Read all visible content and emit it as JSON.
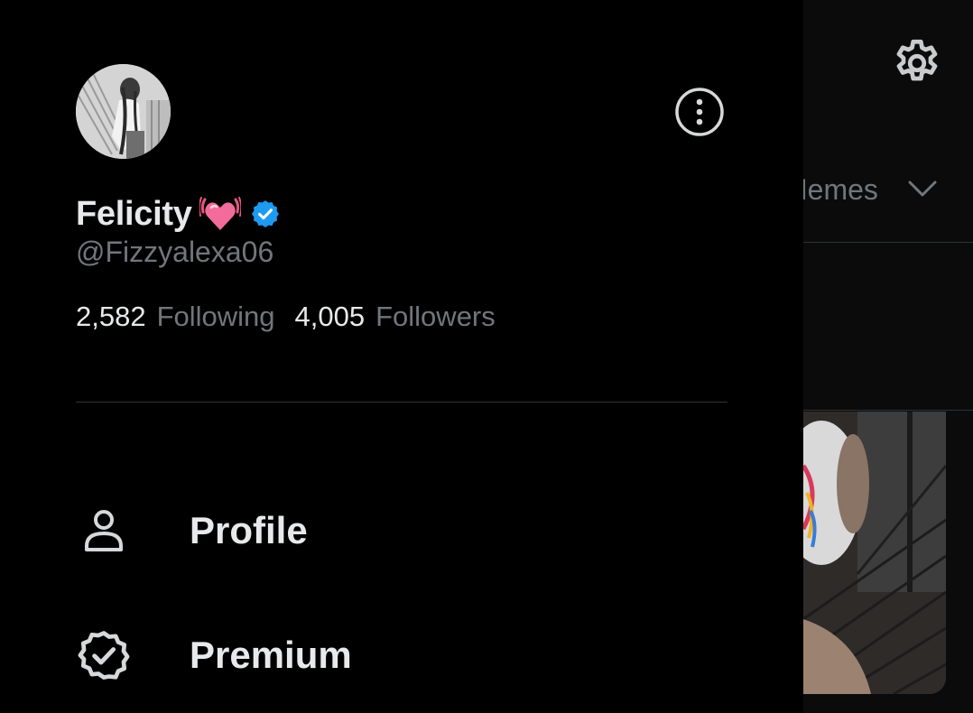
{
  "background": {
    "settings_icon": "gear-icon",
    "tab_label": "Memes",
    "tab_chevron_icon": "chevron-down-icon"
  },
  "drawer": {
    "profile": {
      "display_name": "Felicity",
      "name_emoji": "💓",
      "verified_badge": "verified-badge-icon",
      "handle": "@Fizzyalexa06",
      "following_count": "2,582",
      "following_label": "Following",
      "followers_count": "4,005",
      "followers_label": "Followers"
    },
    "more_icon": "more-options-icon",
    "menu": [
      {
        "label": "Profile",
        "icon": "person-icon"
      },
      {
        "label": "Premium",
        "icon": "premium-badge-icon"
      }
    ]
  },
  "colors": {
    "background": "#000000",
    "primary_text": "#e7e9ea",
    "secondary_text": "#71767b",
    "divider": "#2f3336",
    "verified_blue": "#1d9bf0",
    "heart_pink": "#f26b9a"
  }
}
